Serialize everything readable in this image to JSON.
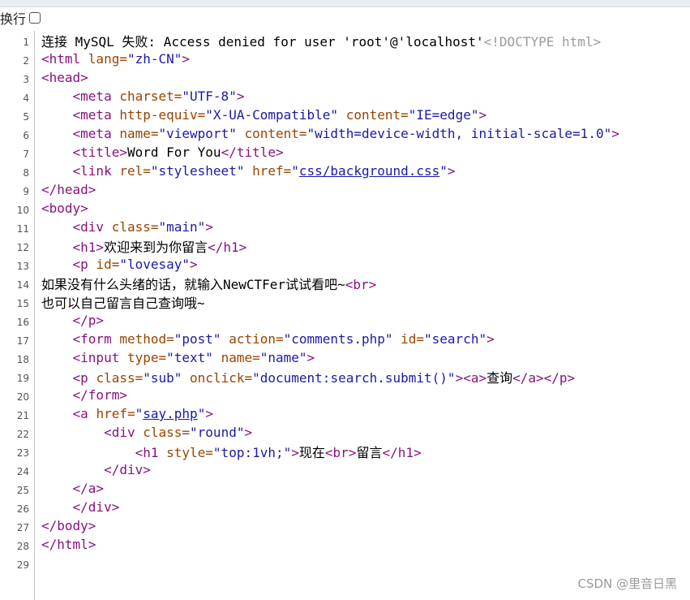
{
  "toolbar": {
    "wrap_label": "换行",
    "wrap_checked": false
  },
  "lines": [
    {
      "n": "1",
      "segs": [
        [
          "t",
          "连接 MySQL 失败: Access denied for user 'root'@'localhost'"
        ],
        [
          "c",
          "<!DOCTYPE html>"
        ]
      ]
    },
    {
      "n": "2",
      "segs": [
        [
          "g",
          "<html "
        ],
        [
          "a",
          "lang="
        ],
        [
          "v",
          "\"zh-CN\""
        ],
        [
          "g",
          ">"
        ]
      ]
    },
    {
      "n": "3",
      "segs": [
        [
          "g",
          "<head>"
        ]
      ]
    },
    {
      "n": "4",
      "segs": [
        [
          "t",
          "    "
        ],
        [
          "g",
          "<meta "
        ],
        [
          "a",
          "charset="
        ],
        [
          "v",
          "\"UTF-8\""
        ],
        [
          "g",
          ">"
        ]
      ]
    },
    {
      "n": "5",
      "segs": [
        [
          "t",
          "    "
        ],
        [
          "g",
          "<meta "
        ],
        [
          "a",
          "http-equiv="
        ],
        [
          "v",
          "\"X-UA-Compatible\""
        ],
        [
          "a",
          " content="
        ],
        [
          "v",
          "\"IE=edge\""
        ],
        [
          "g",
          ">"
        ]
      ]
    },
    {
      "n": "6",
      "segs": [
        [
          "t",
          "    "
        ],
        [
          "g",
          "<meta "
        ],
        [
          "a",
          "name="
        ],
        [
          "v",
          "\"viewport\""
        ],
        [
          "a",
          " content="
        ],
        [
          "v",
          "\"width=device-width, initial-scale=1.0\""
        ],
        [
          "g",
          ">"
        ]
      ]
    },
    {
      "n": "7",
      "segs": [
        [
          "t",
          "    "
        ],
        [
          "g",
          "<title>"
        ],
        [
          "t",
          "Word For You"
        ],
        [
          "g",
          "</title>"
        ]
      ]
    },
    {
      "n": "8",
      "segs": [
        [
          "t",
          "    "
        ],
        [
          "g",
          "<link "
        ],
        [
          "a",
          "rel="
        ],
        [
          "v",
          "\"stylesheet\""
        ],
        [
          "a",
          " href="
        ],
        [
          "v",
          "\""
        ],
        [
          "l",
          "css/background.css"
        ],
        [
          "v",
          "\""
        ],
        [
          "g",
          ">"
        ]
      ]
    },
    {
      "n": "9",
      "segs": [
        [
          "g",
          "</head>"
        ]
      ]
    },
    {
      "n": "10",
      "segs": [
        [
          "g",
          "<body>"
        ]
      ]
    },
    {
      "n": "11",
      "segs": [
        [
          "t",
          "    "
        ],
        [
          "g",
          "<div "
        ],
        [
          "a",
          "class="
        ],
        [
          "v",
          "\"main\""
        ],
        [
          "g",
          ">"
        ]
      ]
    },
    {
      "n": "12",
      "segs": [
        [
          "t",
          "    "
        ],
        [
          "g",
          "<h1>"
        ],
        [
          "t",
          "欢迎来到为你留言"
        ],
        [
          "g",
          "</h1>"
        ]
      ]
    },
    {
      "n": "13",
      "segs": [
        [
          "t",
          "    "
        ],
        [
          "g",
          "<p "
        ],
        [
          "a",
          "id="
        ],
        [
          "v",
          "\"lovesay\""
        ],
        [
          "g",
          ">"
        ]
      ]
    },
    {
      "n": "14",
      "segs": [
        [
          "t",
          "如果没有什么头绪的话，就输入NewCTFer试试看吧~"
        ],
        [
          "g",
          "<br>"
        ]
      ]
    },
    {
      "n": "15",
      "segs": [
        [
          "t",
          "也可以自己留言自己查询哦~"
        ]
      ]
    },
    {
      "n": "16",
      "segs": [
        [
          "t",
          "    "
        ],
        [
          "g",
          "</p>"
        ]
      ]
    },
    {
      "n": "17",
      "segs": [
        [
          "t",
          "    "
        ],
        [
          "g",
          "<form "
        ],
        [
          "a",
          "method="
        ],
        [
          "v",
          "\"post\""
        ],
        [
          "a",
          " action="
        ],
        [
          "v",
          "\"comments.php\""
        ],
        [
          "a",
          " id="
        ],
        [
          "v",
          "\"search\""
        ],
        [
          "g",
          ">"
        ]
      ]
    },
    {
      "n": "18",
      "segs": [
        [
          "t",
          "    "
        ],
        [
          "g",
          "<input "
        ],
        [
          "a",
          "type="
        ],
        [
          "v",
          "\"text\""
        ],
        [
          "a",
          " name="
        ],
        [
          "v",
          "\"name\""
        ],
        [
          "g",
          ">"
        ]
      ]
    },
    {
      "n": "19",
      "segs": [
        [
          "t",
          "    "
        ],
        [
          "g",
          "<p "
        ],
        [
          "a",
          "class="
        ],
        [
          "v",
          "\"sub\""
        ],
        [
          "a",
          " onclick="
        ],
        [
          "v",
          "\"document:search.submit()\""
        ],
        [
          "g",
          "><a>"
        ],
        [
          "t",
          "查询"
        ],
        [
          "g",
          "</a></p>"
        ]
      ]
    },
    {
      "n": "20",
      "segs": [
        [
          "t",
          "    "
        ],
        [
          "g",
          "</form>"
        ]
      ]
    },
    {
      "n": "21",
      "segs": [
        [
          "t",
          "    "
        ],
        [
          "g",
          "<a "
        ],
        [
          "a",
          "href="
        ],
        [
          "v",
          "\""
        ],
        [
          "l",
          "say.php"
        ],
        [
          "v",
          "\""
        ],
        [
          "g",
          ">"
        ]
      ]
    },
    {
      "n": "22",
      "segs": [
        [
          "t",
          "        "
        ],
        [
          "g",
          "<div "
        ],
        [
          "a",
          "class="
        ],
        [
          "v",
          "\"round\""
        ],
        [
          "g",
          ">"
        ]
      ]
    },
    {
      "n": "23",
      "segs": [
        [
          "t",
          "            "
        ],
        [
          "g",
          "<h1 "
        ],
        [
          "a",
          "style="
        ],
        [
          "v",
          "\"top:1vh;\""
        ],
        [
          "g",
          ">"
        ],
        [
          "t",
          "现在"
        ],
        [
          "g",
          "<br>"
        ],
        [
          "t",
          "留言"
        ],
        [
          "g",
          "</h1>"
        ]
      ]
    },
    {
      "n": "24",
      "segs": [
        [
          "t",
          "        "
        ],
        [
          "g",
          "</div>"
        ]
      ]
    },
    {
      "n": "25",
      "segs": [
        [
          "t",
          "    "
        ],
        [
          "g",
          "</a>"
        ]
      ]
    },
    {
      "n": "26",
      "segs": [
        [
          "t",
          "    "
        ],
        [
          "g",
          "</div>"
        ]
      ]
    },
    {
      "n": "27",
      "segs": [
        [
          "g",
          "</body>"
        ]
      ]
    },
    {
      "n": "28",
      "segs": [
        [
          "g",
          "</html>"
        ]
      ]
    },
    {
      "n": "29",
      "segs": []
    }
  ],
  "watermark": "CSDN @里音日黑"
}
